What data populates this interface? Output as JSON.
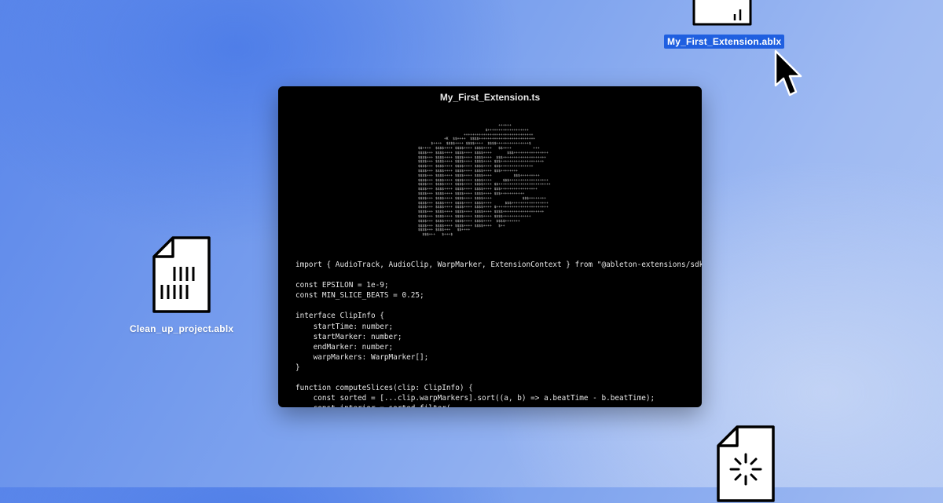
{
  "desktop": {
    "files": [
      {
        "name": "My_First_Extension.ablx",
        "selected": true,
        "icon": "file-icon"
      },
      {
        "name": "Clean_up_project.ablx",
        "selected": false,
        "icon": "file-barcode-icon"
      },
      {
        "name": "",
        "selected": false,
        "icon": "file-burst-icon"
      }
    ]
  },
  "window": {
    "title": "My_First_Extension.ts",
    "ascii_logo": "                                          ++++++\n                                    $+++++++++++++++++++\n                          ++++++++++++++++++++++++++++++++\n                 +K  $$++++  $$$$++++++++++++++++++++++++++\n           $++++  $$$$++++ $$$$++++  $$$$+++++++++++++++$\n     $$++++  $$$$++++ $$$$++++ $$$$++++   $$++++          +++\n     $$$$+++ $$$$++++ $$$$++++ $$$$++++       $$$++++++++++++++++\n     $$$$+++ $$$$++++ $$$$++++ $$$$++++  $$$++++++++++++++++++++\n     $$$$+++ $$$$++++ $$$$++++ $$$$++++ $$$++++++++++++++++++++\n     $$$$+++ $$$$++++ $$$$++++ $$$$++++ $$$+++++++++++++++\n     $$$$+++ $$$$++++ $$$$++++ $$$$++++ $$$++++++++\n     $$$$+++ $$$$++++ $$$$++++ $$$$++++          $$$+++++++++\n     $$$$+++ $$$$++++ $$$$++++ $$$$++++     $$$++++++++++++++++++\n     $$$$+++ $$$$++++ $$$$++++ $$$$++++ $$++++++++++++++++++++++++\n     $$$$+++ $$$$++++ $$$$++++ $$$$++++ $$$+++++++++++++++++\n     $$$$+++ $$$$++++ $$$$++++ $$$$++++ $$$+++++++++++\n     $$$$+++ $$$$++++ $$$$++++ $$$$++++              $$$++++++++\n     $$$$+++ $$$$++++ $$$$++++ $$$$++++      $$$+++++++++++++++++\n     $$$$+++ $$$$++++ $$$$++++ $$$$++++ $++++++++++++++++++++++++\n     $$$$+++ $$$$++++ $$$$++++ $$$$++++ $$$$+++++++++++++++++++\n     $$$$+++ $$$$++++ $$$$++++ $$$$++++ $$$$+++++++++++++\n     $$$$+++ $$$$++++ $$$$++++ $$$$++++  $$$$+++++++\n     $$$$+++ $$$$++++ $$$$++++ $$$$++++   $++\n     $$$$+++ $$$$+++   $$++++\n       $$$+++   $+++$",
    "code": "import { AudioTrack, AudioClip, WarpMarker, ExtensionContext } from \"@ableton-extensions/sdk\";\n\nconst EPSILON = 1e-9;\nconst MIN_SLICE_BEATS = 0.25;\n\ninterface ClipInfo {\n    startTime: number;\n    startMarker: number;\n    endMarker: number;\n    warpMarkers: WarpMarker[];\n}\n\nfunction computeSlices(clip: ClipInfo) {\n    const sorted = [...clip.warpMarkers].sort((a, b) => a.beatTime - b.beatTime);\n    const interior = sorted.filter("
  },
  "colors": {
    "selection": "#1f5fe0",
    "window_bg": "#000000",
    "desktop_top": "#4f7ee8",
    "desktop_bottom": "#aec5f4"
  }
}
